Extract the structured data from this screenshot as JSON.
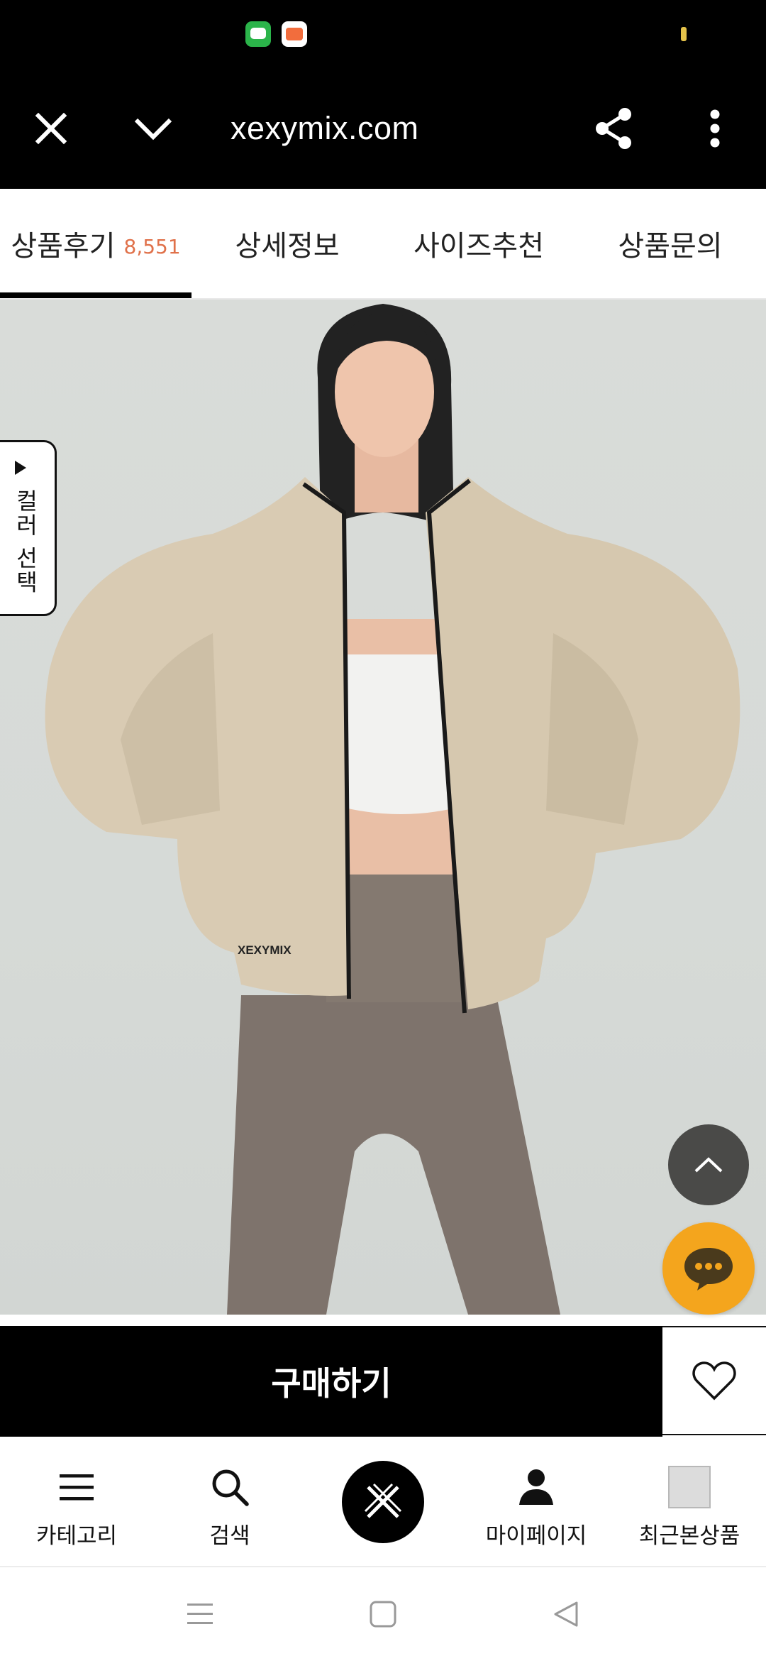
{
  "browser": {
    "url": "xexymix.com"
  },
  "tabs": [
    {
      "label": "상품후기",
      "count": "8,551",
      "active": true
    },
    {
      "label": "상세정보",
      "active": false
    },
    {
      "label": "사이즈추천",
      "active": false
    },
    {
      "label": "상품문의",
      "active": false
    }
  ],
  "product": {
    "color_select_label": "컬러 선택",
    "image_brand_text": "XEXYMIX"
  },
  "buy": {
    "buy_label": "구매하기"
  },
  "bottom_nav": {
    "category": "카테고리",
    "search": "검색",
    "mypage": "마이페이지",
    "recent": "최근본상품"
  },
  "icons": [
    "close-icon",
    "chevron-down-icon",
    "share-icon",
    "more-vert-icon",
    "scroll-top-icon",
    "chat-icon",
    "heart-icon",
    "menu-icon",
    "search-icon",
    "logo-icon",
    "person-icon",
    "recent-product-thumb",
    "recents-icon",
    "home-icon",
    "back-icon"
  ],
  "colors": {
    "accent_count": "#e0714a",
    "chat_button": "#f4a51d",
    "jacket": "#d9cbb3",
    "shorts": "#7e736c"
  }
}
